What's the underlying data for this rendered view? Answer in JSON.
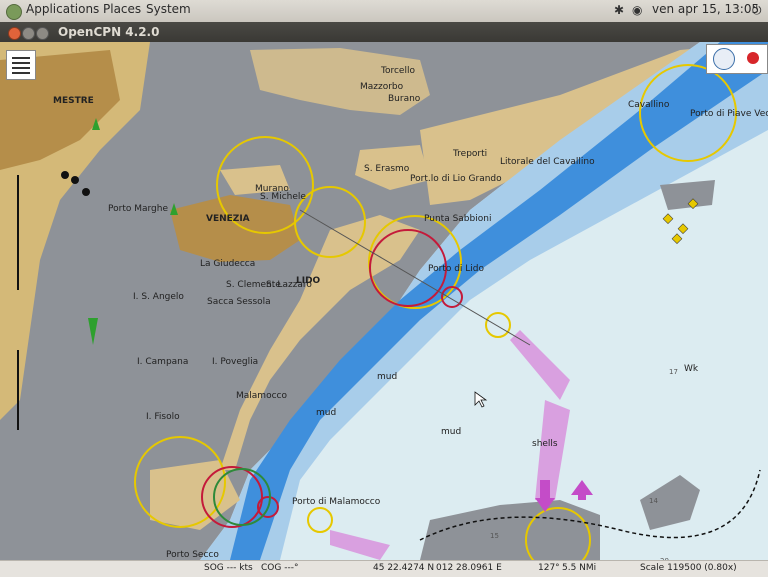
{
  "panel": {
    "menu": [
      "Applications",
      "Places",
      "System"
    ],
    "datetime": "ven apr 15, 13:05"
  },
  "window": {
    "title": "OpenCPN 4.2.0"
  },
  "map_labels": {
    "mestre": "MESTRE",
    "porto_marghera": "Porto Marghe",
    "venezia": "VENEZIA",
    "murano": "Murano",
    "s_michele": "S. Michele",
    "la_giudecca": "La Giudecca",
    "s_clemente": "S. Clemente",
    "lazzaro": "S. Lazzaro",
    "lido": "LIDO",
    "sacca_sessola": "Sacca Sessola",
    "s_angelo": "I. S. Angelo",
    "i_campana": "I. Campana",
    "i_poveglia": "I. Poveglia",
    "malamocco": "Malamocco",
    "i_fisolo": "I. Fisolo",
    "torcello": "Torcello",
    "mazzorbo": "Mazzorbo",
    "burano": "Burano",
    "s_erasmo": "S. Erasmo",
    "treporti": "Treporti",
    "porto_lio_grando": "Port.lo di Lio Grando",
    "litorale_cavallino": "Litorale del Cavallino",
    "cavallino": "Cavallino",
    "porto_piave_vecchia": "Porto di Piave Vec",
    "punta_sabbioni": "Punta Sabbioni",
    "porto_lido": "Porto di Lido",
    "porto_malamocco": "Porto di Malamocco",
    "porto_secco": "Porto Secco",
    "mud1": "mud",
    "mud2": "mud",
    "mud3": "mud",
    "shells": "shells",
    "wk": "Wk",
    "depth_17": "17",
    "depth_14": "14",
    "depth_15": "15",
    "depth_20": "20"
  },
  "status": {
    "sog": "SOG --- kts",
    "cog": "COG ---°",
    "lat": "45 22.4274 N",
    "lon": "012 28.0961 E",
    "bearing": "127°",
    "distance": "5.5 NMi",
    "scale": "Scale 119500 (0.80x)"
  },
  "icons": {
    "toolbar": "chart-toolbar-icon",
    "compass": "compass-icon",
    "gps": "gps-status-icon"
  },
  "colors": {
    "land": "#d9c18c",
    "urban": "#b58e4a",
    "shallow_water": "#9fc7e8",
    "channel": "#3f8fdc",
    "deep_water": "#dcecf1",
    "lagoon_gray": "#8a8e94",
    "light_circle": "#e6c800"
  }
}
